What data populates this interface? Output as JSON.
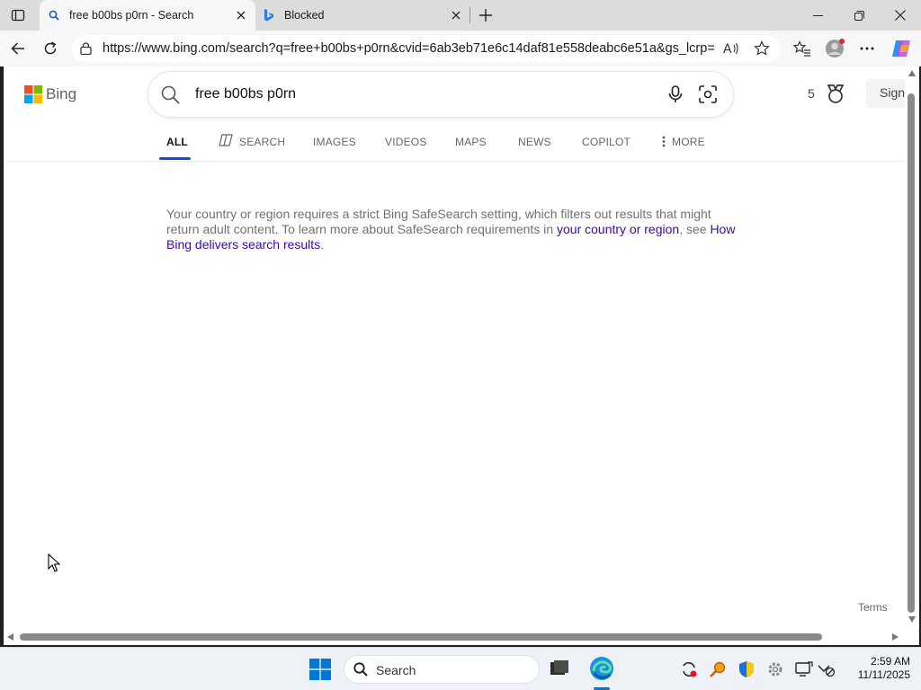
{
  "browser": {
    "tabs": [
      {
        "title": "free b00bs p0rn - Search",
        "active": true
      },
      {
        "title": "Blocked",
        "active": false
      }
    ],
    "url": "https://www.bing.com/search?q=free+b00bs+p0rn&cvid=6ab3eb71e6c14daf81e558deabc6e51a&gs_lcrp=E..."
  },
  "bing": {
    "logo_text": "Bing",
    "query": "free b00bs p0rn",
    "rewards_count": "5",
    "sign_in_label": "Sign",
    "nav": [
      "ALL",
      "SEARCH",
      "IMAGES",
      "VIDEOS",
      "MAPS",
      "NEWS",
      "COPILOT",
      "MORE"
    ],
    "nav_active": "ALL",
    "message": {
      "part1": "Your country or region requires a strict Bing SafeSearch setting, which filters out results that might return adult content. To learn more about SafeSearch requirements in ",
      "link1": "your country or region",
      "part2": ", see ",
      "link2": "How Bing delivers search results",
      "part3": "."
    },
    "terms_label": "Terms"
  },
  "taskbar": {
    "search_placeholder": "Search",
    "time": "2:59 AM",
    "date": "11/11/2025"
  },
  "colors": {
    "tab_bar": "#dcdcdc",
    "link": "#4007a2",
    "nav_active_underline": "#174ae4",
    "windows_blue": "#0078d4"
  }
}
